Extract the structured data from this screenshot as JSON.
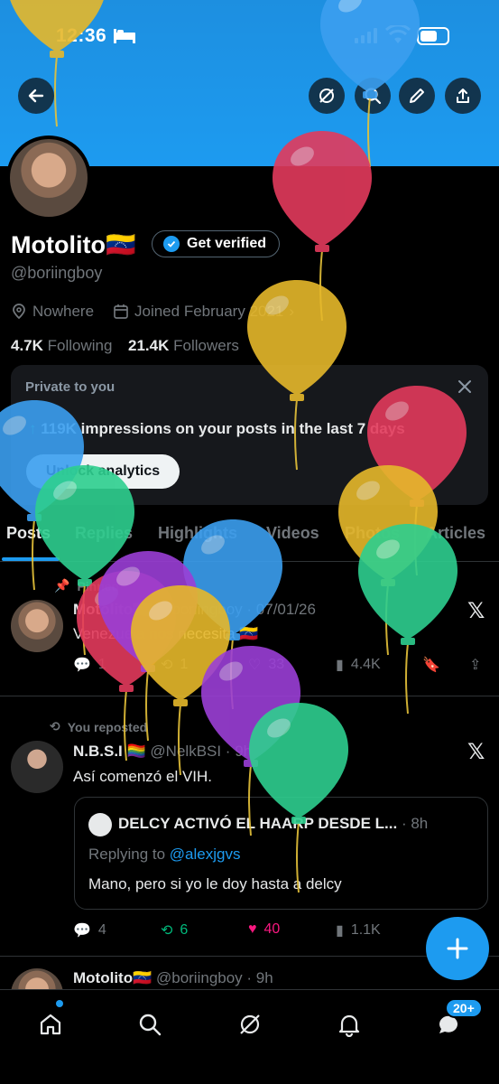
{
  "status_bar": {
    "time": "12:36"
  },
  "profile": {
    "name": "Motolito",
    "flag": "🇻🇪",
    "verify_label": "Get verified",
    "handle": "@boriingboy",
    "location": "Nowhere",
    "joined": "Joined February 2021",
    "following_count": "4.7K",
    "following_label": "Following",
    "followers_count": "21.4K",
    "followers_label": "Followers"
  },
  "analytics_card": {
    "title": "Private to you",
    "impressions_text": "119K impressions on your posts in the last 7 days",
    "button_label": "Unlock analytics"
  },
  "tabs": [
    "Posts",
    "Replies",
    "Highlights",
    "Videos",
    "Photos",
    "Articles"
  ],
  "posts": [
    {
      "pinned_label": "Pinned",
      "author": "Motolito🇻🇪",
      "handle_date": "@boriingboy · 07/01/26",
      "text": "Venezuela nos necesita 🇻🇪",
      "replies": "1",
      "reposts": "1",
      "likes": "33",
      "views": "4.4K"
    },
    {
      "repost_label": "You reposted",
      "author": "N.B.S.I 🏳️‍🌈",
      "handle_date": "@NelkBSI · 9h",
      "text": "Así comenzó el VIH.",
      "quote_title": "DELCY ACTIVÓ EL HAARP DESDE L...",
      "quote_time": "· 8h",
      "quote_replying": "Replying to",
      "quote_replying_to": "@alexjgvs",
      "quote_text": "Mano, pero si yo le doy hasta a delcy",
      "replies": "4",
      "reposts": "6",
      "likes": "40",
      "views": "1.1K"
    },
    {
      "author": "Motolito🇻🇪",
      "handle_date": "@boriingboy · 9h"
    }
  ],
  "nav": {
    "messages_badge": "20+"
  },
  "colors": {
    "accent": "#1d9bf0",
    "background": "#000000",
    "like": "#f91880",
    "repost": "#00ba7c"
  },
  "balloons": [
    "#3b9ff0",
    "#e33a5c",
    "#e6b82b",
    "#2ecf8f",
    "#9b3fd6"
  ]
}
